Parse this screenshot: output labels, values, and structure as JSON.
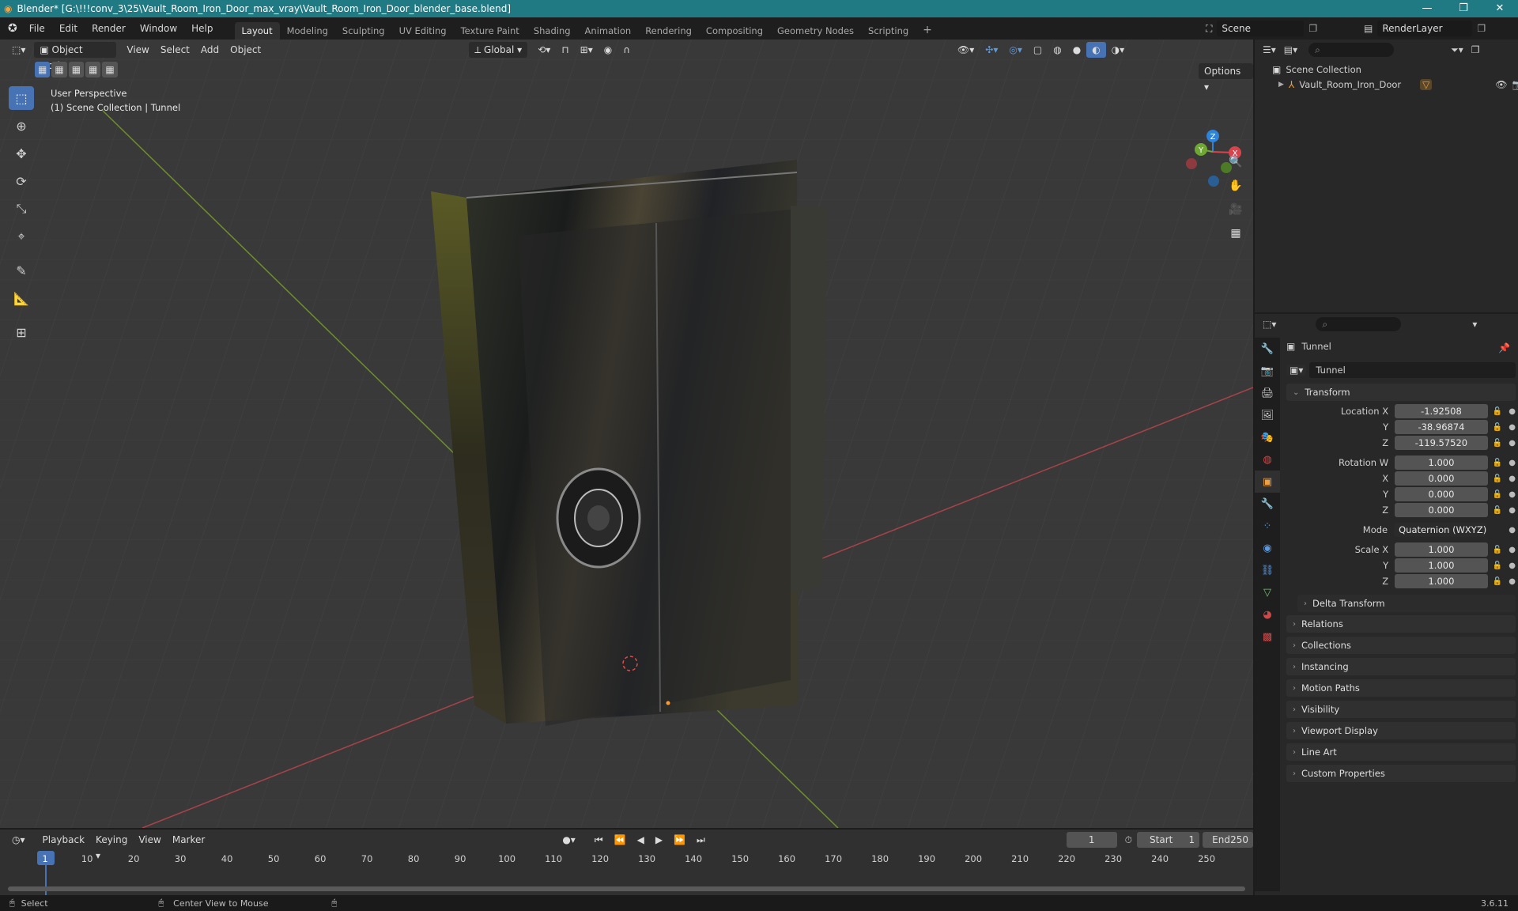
{
  "window": {
    "title": "Blender* [G:\\!!!conv_3\\25\\Vault_Room_Iron_Door_max_vray\\Vault_Room_Iron_Door_blender_base.blend]",
    "controls": [
      "—",
      "❐",
      "✕"
    ]
  },
  "menu": [
    "File",
    "Edit",
    "Render",
    "Window",
    "Help"
  ],
  "workspaces": [
    "Layout",
    "Modeling",
    "Sculpting",
    "UV Editing",
    "Texture Paint",
    "Shading",
    "Animation",
    "Rendering",
    "Compositing",
    "Geometry Nodes",
    "Scripting"
  ],
  "workspace_add": "+",
  "scene": {
    "name": "Scene",
    "render_layer": "RenderLayer"
  },
  "viewport": {
    "mode": "Object Mode",
    "menus": [
      "View",
      "Select",
      "Add",
      "Object"
    ],
    "transform_orientation": "Global",
    "options_label": "Options",
    "overlay_line1": "User Perspective",
    "overlay_line2": "(1) Scene Collection | Tunnel",
    "gizmo": {
      "x": "X",
      "y": "Y",
      "z": "Z"
    }
  },
  "outliner": {
    "root": "Scene Collection",
    "items": [
      {
        "name": "Vault_Room_Iron_Door"
      }
    ]
  },
  "properties": {
    "object_name": "Tunnel",
    "datablock_name": "Tunnel",
    "transform": {
      "header": "Transform",
      "location_label": "Location X",
      "location": [
        "-1.92508",
        "-38.96874",
        "-119.57520"
      ],
      "rotation_label": "Rotation W",
      "rotation": [
        "1.000",
        "0.000",
        "0.000",
        "0.000"
      ],
      "mode_label": "Mode",
      "mode": "Quaternion (WXYZ)",
      "scale_label": "Scale X",
      "scale": [
        "1.000",
        "1.000",
        "1.000"
      ],
      "y_label": "Y",
      "z_label": "Z",
      "x_label": "X",
      "delta": "Delta Transform"
    },
    "panels": [
      "Relations",
      "Collections",
      "Instancing",
      "Motion Paths",
      "Visibility",
      "Viewport Display",
      "Line Art",
      "Custom Properties"
    ]
  },
  "timeline": {
    "menus": [
      "Playback",
      "Keying",
      "View",
      "Marker"
    ],
    "current_frame": "1",
    "start_label": "Start",
    "start": "1",
    "end_label": "End",
    "end": "250",
    "ruler": [
      "1",
      "10",
      "20",
      "30",
      "40",
      "50",
      "60",
      "70",
      "80",
      "90",
      "100",
      "110",
      "120",
      "130",
      "140",
      "150",
      "160",
      "170",
      "180",
      "190",
      "200",
      "210",
      "220",
      "230",
      "240",
      "250"
    ]
  },
  "status": {
    "left": "Select",
    "middle": "Center View to Mouse",
    "version": "3.6.11"
  },
  "colors": {
    "title_bar": "#1f7a84",
    "accent": "#4772b3",
    "x_axis": "#d9434e",
    "y_axis": "#6ea832",
    "z_axis": "#2f83d8"
  }
}
